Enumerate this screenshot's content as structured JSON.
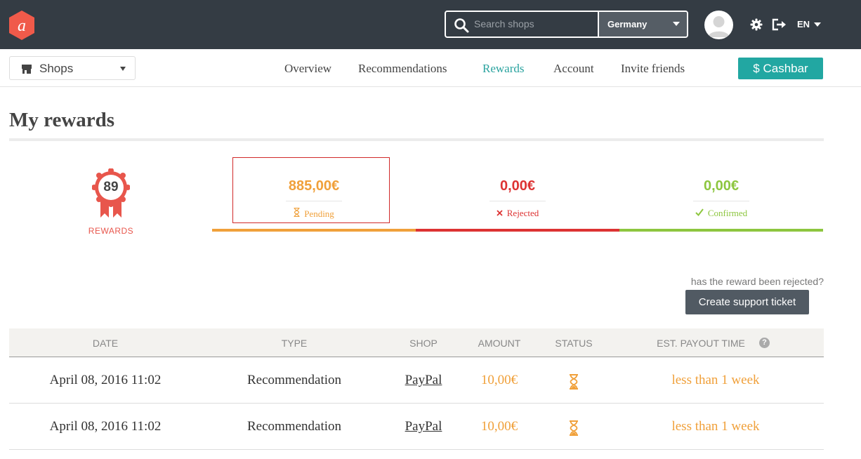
{
  "colors": {
    "topbar": "#343c44",
    "accent": "#22a7a2",
    "pending": "#f0a03a",
    "rejected": "#dd3333",
    "confirmed": "#8dc63f",
    "badge": "#e8564c"
  },
  "header": {
    "logo_icon": "brand-logo-icon",
    "search": {
      "placeholder": "Search shops",
      "icon": "search-icon"
    },
    "country": "Germany",
    "language": "EN",
    "icons": [
      "avatar",
      "gear-icon",
      "logout-icon"
    ]
  },
  "nav": {
    "shops_label": "Shops",
    "links": [
      "Overview",
      "Recommendations",
      "Rewards",
      "Account",
      "Invite friends"
    ],
    "active": "Rewards",
    "cashbar_label": "$ Cashbar"
  },
  "page": {
    "title": "My rewards"
  },
  "summary": {
    "rewards_count": "89",
    "rewards_label": "REWARDS",
    "pending": {
      "value": "885,00€",
      "label": "Pending",
      "icon": "hourglass-icon"
    },
    "rejected": {
      "value": "0,00€",
      "label": "Rejected",
      "icon": "close-icon"
    },
    "confirmed": {
      "value": "0,00€",
      "label": "Confirmed",
      "icon": "check-icon"
    }
  },
  "support": {
    "help_text": "has the reward been rejected?",
    "button_label": "Create support ticket"
  },
  "table": {
    "columns": [
      "DATE",
      "TYPE",
      "SHOP",
      "AMOUNT",
      "STATUS",
      "EST. PAYOUT TIME"
    ],
    "rows": [
      {
        "date": "April 08, 2016 11:02",
        "type": "Recommendation",
        "shop": "PayPal",
        "amount": "10,00€",
        "status": "pending",
        "payout": "less than 1 week"
      },
      {
        "date": "April 08, 2016 11:02",
        "type": "Recommendation",
        "shop": "PayPal",
        "amount": "10,00€",
        "status": "pending",
        "payout": "less than 1 week"
      }
    ]
  }
}
